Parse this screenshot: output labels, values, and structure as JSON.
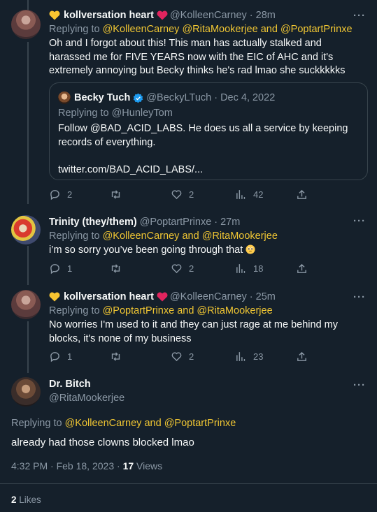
{
  "tweets": [
    {
      "name": "kollversation heart",
      "handle": "@KolleenCarney",
      "sep": "·",
      "time": "28m",
      "replying_prefix": "Replying to",
      "mentions": [
        "@KolleenCarney",
        "@RitaMookerjee",
        "and",
        "@PoptartPrinxe"
      ],
      "text": "Oh and I forgot about this! This man has actually stalked and harassed me for FIVE YEARS now with the EIC of AHC and it's extremely annoying but Becky thinks he's rad lmao she suckkkkks",
      "quote": {
        "name": "Becky Tuch",
        "handle": "@BeckyLTuch",
        "sep": "·",
        "date": "Dec 4, 2022",
        "replying_prefix": "Replying to",
        "replying_handle": "@HunleyTom",
        "text": "Follow @BAD_ACID_LABS. He does us all a service by keeping records of everything.",
        "link": "twitter.com/BAD_ACID_LABS/..."
      },
      "stats": {
        "replies": "2",
        "retweets": "",
        "likes": "2",
        "views": "42"
      }
    },
    {
      "name": "Trinity (they/them)",
      "handle": "@PoptartPrinxe",
      "sep": "·",
      "time": "27m",
      "replying_prefix": "Replying to",
      "mentions": [
        "@KolleenCarney",
        "and",
        "@RitaMookerjee"
      ],
      "text": "i’m so sorry you’ve been going through that",
      "stats": {
        "replies": "1",
        "retweets": "",
        "likes": "2",
        "views": "18"
      }
    },
    {
      "name": "kollversation heart",
      "handle": "@KolleenCarney",
      "sep": "·",
      "time": "25m",
      "replying_prefix": "Replying to",
      "mentions": [
        "@PoptartPrinxe",
        "and",
        "@RitaMookerjee"
      ],
      "text": "No worries I'm used to it and they can just rage at me behind my blocks, it's none of my business",
      "stats": {
        "replies": "1",
        "retweets": "",
        "likes": "2",
        "views": "23"
      }
    }
  ],
  "main": {
    "name": "Dr. Bitch",
    "handle": "@RitaMookerjee",
    "replying_prefix": "Replying to",
    "mentions": [
      "@KolleenCarney",
      "and",
      "@PoptartPrinxe"
    ],
    "text": "already had those clowns blocked lmao",
    "time": "4:32 PM",
    "sep": "·",
    "date": "Feb 18, 2023",
    "views_count": "17",
    "views_label": "Views",
    "likes_count": "2",
    "likes_label": "Likes"
  },
  "icons": {
    "reply": "reply-icon",
    "retweet": "retweet-icon",
    "like": "like-icon",
    "views": "views-icon",
    "share": "share-icon",
    "more": "more-icon",
    "verified": "verified-badge-icon"
  },
  "colors": {
    "background": "#15202b",
    "mention": "#f0c633",
    "secondary_text": "#8b98a5",
    "border": "#38444d"
  }
}
